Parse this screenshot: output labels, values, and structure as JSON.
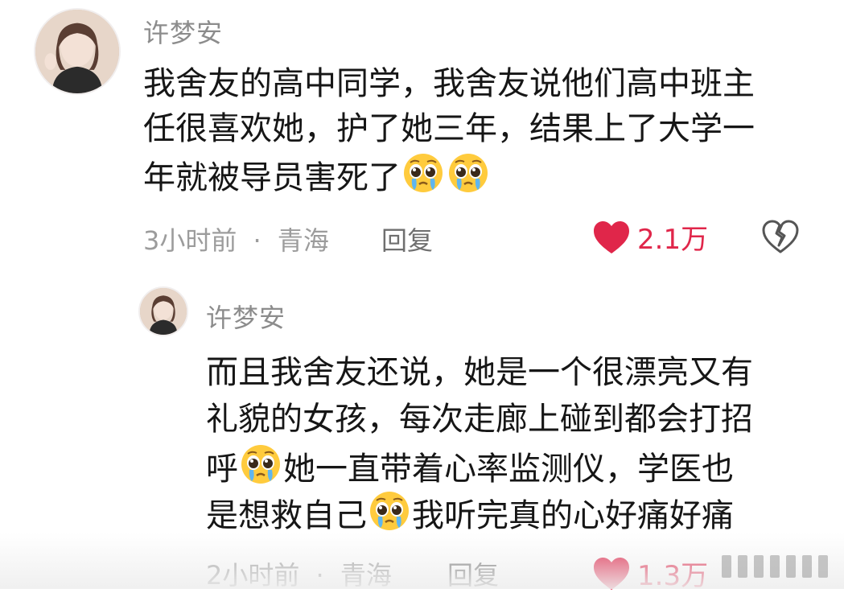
{
  "comments": [
    {
      "username": "许梦安",
      "lines": [
        "我舍友的高中同学，我舍友说他们高中班主",
        "任很喜欢她，护了她三年，结果上了大学一",
        "年就被导员害死了"
      ],
      "time": "3小时前",
      "location": "青海",
      "reply_label": "回复",
      "likes": "2.1万"
    },
    {
      "username": "许梦安",
      "line1": "而且我舍友还说，她是一个很漂亮又有",
      "line2": "礼貌的女孩，每次走廊上碰到都会打招",
      "line3a": "呼",
      "line3b": "她一直带着心率监测仪，学医也",
      "line4a": "是想救自己",
      "line4b": "我听完真的心好痛好痛",
      "time": "2小时前",
      "location": "青海",
      "reply_label": "回复",
      "likes": "1.3万"
    }
  ],
  "separator": "·",
  "icons": {
    "like": "heart-icon",
    "dislike": "broken-heart-icon",
    "emoji": "pleading-face-emoji"
  },
  "colors": {
    "like": "#e0264a",
    "meta": "#9c9c9c",
    "username": "#8c8c8c",
    "text": "#161616"
  }
}
